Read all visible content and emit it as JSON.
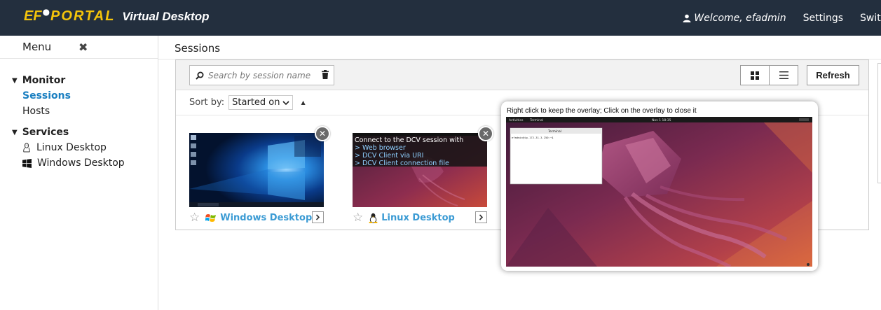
{
  "header": {
    "brand_ef": "EF",
    "brand_portal": "PORTAL",
    "brand_product": "Virtual Desktop",
    "welcome": "Welcome, efadmin",
    "settings": "Settings",
    "switch_partial": "Swit"
  },
  "sidebar": {
    "menu_label": "Menu",
    "groups": [
      {
        "title": "Monitor",
        "items": [
          {
            "label": "Sessions",
            "active": true
          },
          {
            "label": "Hosts",
            "active": false
          }
        ]
      },
      {
        "title": "Services",
        "items": [
          {
            "label": "Linux Desktop",
            "icon": "linux-icon"
          },
          {
            "label": "Windows Desktop",
            "icon": "windows-icon"
          }
        ]
      }
    ]
  },
  "main": {
    "title": "Sessions",
    "search": {
      "placeholder": "Search by session name"
    },
    "refresh_label": "Refresh",
    "sort": {
      "label": "Sort by:",
      "selected": "Started on"
    },
    "sessions": [
      {
        "name": "Windows Desktop",
        "os_icon": "windows-logo-icon"
      },
      {
        "name": "Linux Desktop",
        "os_icon": "linux-icon",
        "connect_title": "Connect to the DCV session with",
        "connect_options": [
          "> Web browser",
          "> DCV Client via URI",
          "> DCV Client connection file"
        ]
      }
    ]
  },
  "overlay": {
    "message": "Right click to keep the overlay; Click on the overlay to close it",
    "activities": "Activities",
    "terminal_tab": "Terminal",
    "clock": "Nov 1 18:35",
    "terminal_title": "Terminal",
    "prompt": "efadmin@ip-172-31-3-250:~$"
  },
  "colors": {
    "topbar": "#232f3e",
    "brand": "#f4c40b",
    "link_active": "#1a7fc1",
    "session_name": "#3b9bd4",
    "ubuntu_wallpaper": "#6e2a4b"
  }
}
